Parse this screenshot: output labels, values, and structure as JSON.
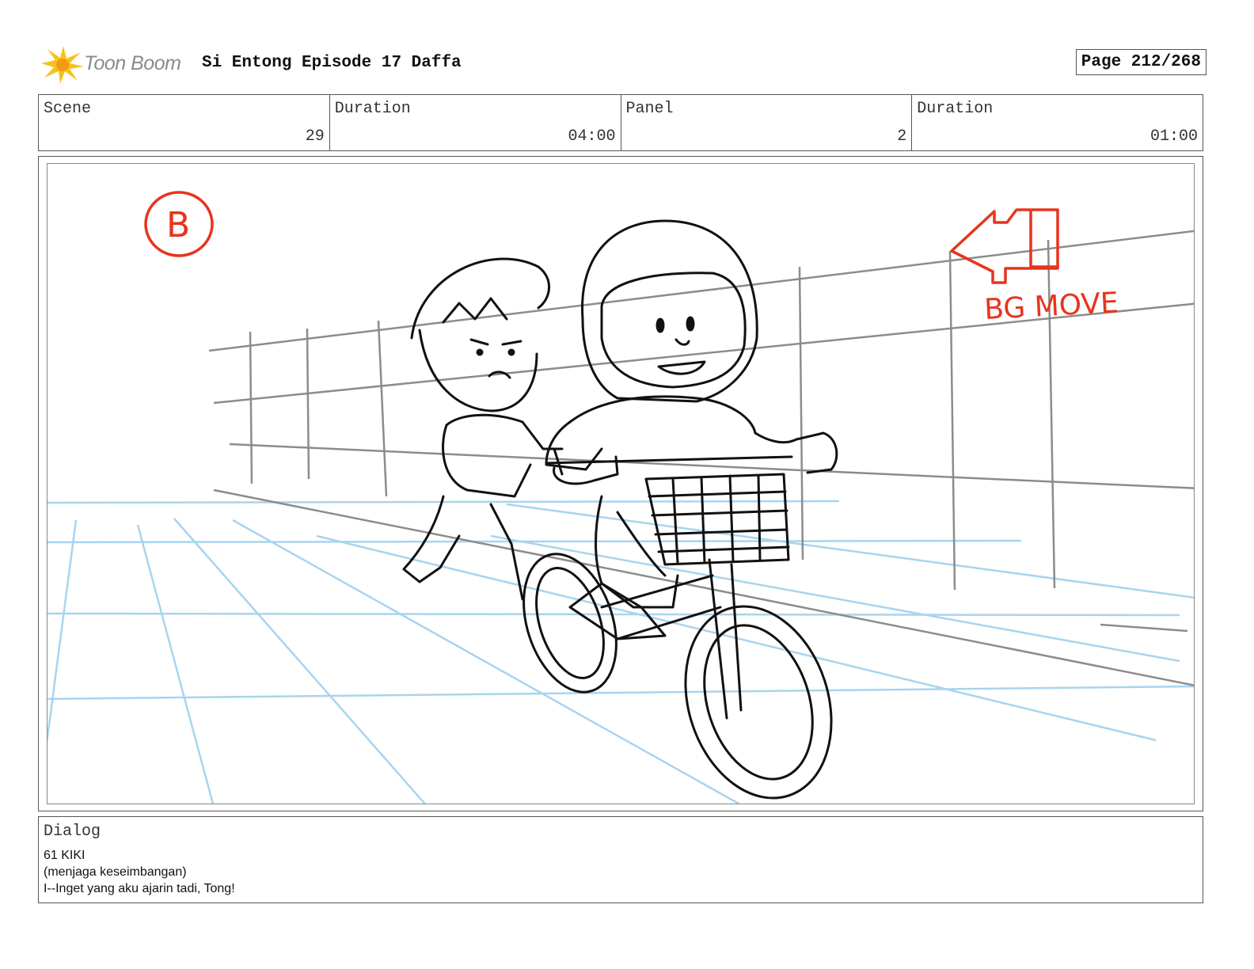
{
  "header": {
    "brand": "Toon Boom",
    "title": "Si Entong Episode 17 Daffa",
    "page": "Page 212/268"
  },
  "info": {
    "scene_label": "Scene",
    "scene_value": "29",
    "scene_duration_label": "Duration",
    "scene_duration_value": "04:00",
    "panel_label": "Panel",
    "panel_value": "2",
    "panel_duration_label": "Duration",
    "panel_duration_value": "01:00"
  },
  "panel": {
    "marker_letter": "B",
    "bg_note": "BG MOVE",
    "sketch_color": "#e8341c",
    "layout_color": "#8c8c8c",
    "ground_color": "#a8d4ef"
  },
  "dialog": {
    "label": "Dialog",
    "lines": [
      "61 KIKI",
      "(menjaga keseimbangan)",
      "I--Inget yang aku ajarin tadi, Tong!"
    ]
  }
}
